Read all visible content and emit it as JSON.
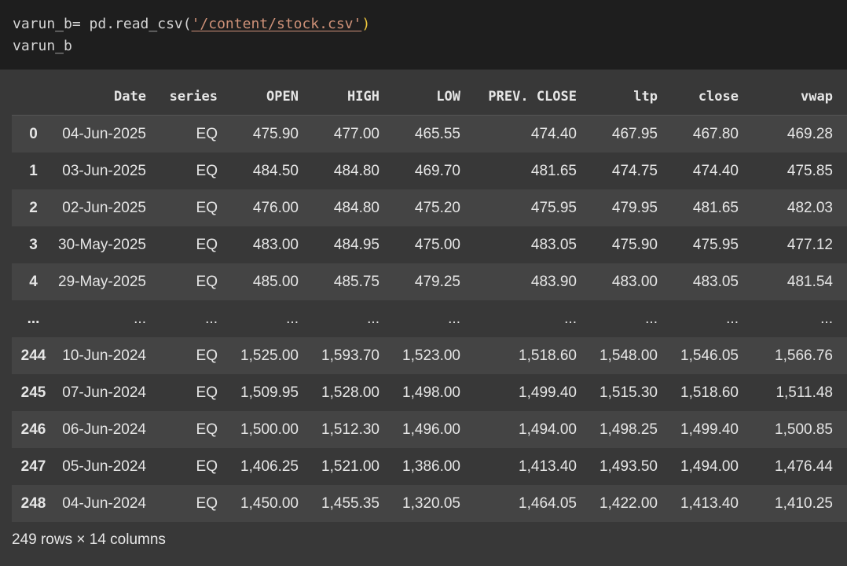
{
  "code": {
    "line1_prefix": "varun_b= pd.read_csv(",
    "line1_open_quote": "'",
    "line1_path": "/content/stock.csv",
    "line1_close_quote": "'",
    "line1_suffix": ")",
    "line2": "varun_b"
  },
  "table": {
    "columns": [
      "Date",
      "series",
      "OPEN",
      "HIGH",
      "LOW",
      "PREV. CLOSE",
      "ltp",
      "close",
      "vwap"
    ],
    "rows": [
      {
        "index": "0",
        "cells": [
          "04-Jun-2025",
          "EQ",
          "475.90",
          "477.00",
          "465.55",
          "474.40",
          "467.95",
          "467.80",
          "469.28"
        ]
      },
      {
        "index": "1",
        "cells": [
          "03-Jun-2025",
          "EQ",
          "484.50",
          "484.80",
          "469.70",
          "481.65",
          "474.75",
          "474.40",
          "475.85"
        ]
      },
      {
        "index": "2",
        "cells": [
          "02-Jun-2025",
          "EQ",
          "476.00",
          "484.80",
          "475.20",
          "475.95",
          "479.95",
          "481.65",
          "482.03"
        ]
      },
      {
        "index": "3",
        "cells": [
          "30-May-2025",
          "EQ",
          "483.00",
          "484.95",
          "475.00",
          "483.05",
          "475.90",
          "475.95",
          "477.12"
        ]
      },
      {
        "index": "4",
        "cells": [
          "29-May-2025",
          "EQ",
          "485.00",
          "485.75",
          "479.25",
          "483.90",
          "483.00",
          "483.05",
          "481.54"
        ]
      },
      {
        "index": "...",
        "cells": [
          "...",
          "...",
          "...",
          "...",
          "...",
          "...",
          "...",
          "...",
          "..."
        ]
      },
      {
        "index": "244",
        "cells": [
          "10-Jun-2024",
          "EQ",
          "1,525.00",
          "1,593.70",
          "1,523.00",
          "1,518.60",
          "1,548.00",
          "1,546.05",
          "1,566.76"
        ]
      },
      {
        "index": "245",
        "cells": [
          "07-Jun-2024",
          "EQ",
          "1,509.95",
          "1,528.00",
          "1,498.00",
          "1,499.40",
          "1,515.30",
          "1,518.60",
          "1,511.48"
        ]
      },
      {
        "index": "246",
        "cells": [
          "06-Jun-2024",
          "EQ",
          "1,500.00",
          "1,512.30",
          "1,496.00",
          "1,494.00",
          "1,498.25",
          "1,499.40",
          "1,500.85"
        ]
      },
      {
        "index": "247",
        "cells": [
          "05-Jun-2024",
          "EQ",
          "1,406.25",
          "1,521.00",
          "1,386.00",
          "1,413.40",
          "1,493.50",
          "1,494.00",
          "1,476.44"
        ]
      },
      {
        "index": "248",
        "cells": [
          "04-Jun-2024",
          "EQ",
          "1,450.00",
          "1,455.35",
          "1,320.05",
          "1,464.05",
          "1,422.00",
          "1,413.40",
          "1,410.25"
        ]
      }
    ]
  },
  "footer": {
    "summary": "249 rows × 14 columns"
  },
  "colors": {
    "code_bg": "#1e1e1e",
    "output_bg": "#383838",
    "row_alt_bg": "#444444",
    "string_color": "#ce9178",
    "paren_color": "#f0c93c"
  }
}
